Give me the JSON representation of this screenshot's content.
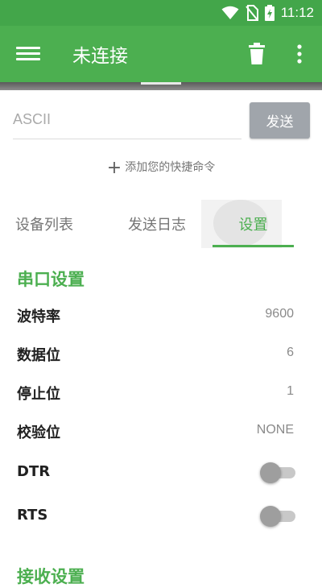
{
  "status_bar": {
    "time": "11:12",
    "icons": [
      "wifi-icon",
      "no-sim-icon",
      "battery-charging-icon"
    ]
  },
  "app_bar": {
    "title": "未连接",
    "menu_icon": "menu-icon",
    "delete_icon": "trash-icon",
    "more_icon": "more-vert-icon",
    "color": "#4caf50"
  },
  "send_panel": {
    "input_value": "",
    "input_placeholder": "ASCII",
    "send_label": "发送",
    "quick_add_label": "添加您的快捷命令"
  },
  "tabs": [
    {
      "label": "设备列表",
      "active": false
    },
    {
      "label": "发送日志",
      "active": false
    },
    {
      "label": "设置",
      "active": true
    }
  ],
  "serial_settings": {
    "title": "串口设置",
    "rows": [
      {
        "label": "波特率",
        "value": "9600"
      },
      {
        "label": "数据位",
        "value": "6"
      },
      {
        "label": "停止位",
        "value": "1"
      },
      {
        "label": "校验位",
        "value": "NONE"
      }
    ],
    "toggles": [
      {
        "label": "DTR",
        "on": false
      },
      {
        "label": "RTS",
        "on": false
      }
    ]
  },
  "receive_settings": {
    "title": "接收设置"
  }
}
